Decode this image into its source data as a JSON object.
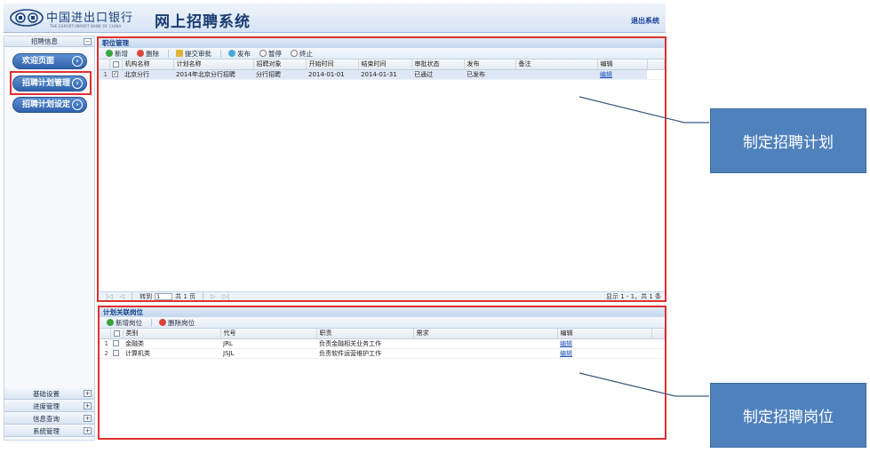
{
  "header": {
    "bank_name_cn": "中国进出口银行",
    "bank_name_en": "THE EXPORT-IMPORT BANK OF CHINA",
    "system_title": "网上招聘系统",
    "logout": "退出系统"
  },
  "sidebar": {
    "section_title": "招聘信息",
    "buttons": [
      {
        "label": "欢迎页面"
      },
      {
        "label": "招聘计划管理"
      },
      {
        "label": "招聘计划设定"
      }
    ],
    "accordion": [
      {
        "label": "基础设置"
      },
      {
        "label": "进度管理"
      },
      {
        "label": "信息查询"
      },
      {
        "label": "系统管理"
      }
    ]
  },
  "plan_panel": {
    "title": "职位管理",
    "toolbar": [
      "新增",
      "删除",
      "提交审批",
      "发布",
      "暂停",
      "终止"
    ],
    "columns": [
      "机构名称",
      "计划名称",
      "招聘对象",
      "开始时间",
      "结束时间",
      "审批状态",
      "发布",
      "备注",
      "编辑"
    ],
    "rows": [
      {
        "num": "1",
        "checked": "✓",
        "org": "北京分行",
        "plan": "2014年北京分行招聘",
        "target": "分行招聘",
        "start": "2014-01-01",
        "end": "2014-01-31",
        "status": "已通过",
        "publish": "已发布",
        "remark": "",
        "edit": "编辑"
      }
    ],
    "pager": {
      "goto_label": "转到",
      "page_value": "1",
      "total_pages": "共 1 页",
      "summary": "显示 1 - 1，共 1 条"
    }
  },
  "post_panel": {
    "title": "计划关联岗位",
    "toolbar": [
      "新增岗位",
      "删除岗位"
    ],
    "columns": [
      "类别",
      "代号",
      "职责",
      "需求",
      "编辑"
    ],
    "rows": [
      {
        "num": "1",
        "category": "金融类",
        "code": "JRL",
        "duty": "负责金融相关业务工作",
        "need": "",
        "edit": "编辑"
      },
      {
        "num": "2",
        "category": "计算机类",
        "code": "JSJL",
        "duty": "负责软件运营维护工作",
        "need": "",
        "edit": "编辑"
      }
    ]
  },
  "callouts": {
    "plan": "制定招聘计划",
    "post": "制定招聘岗位"
  },
  "colors": {
    "accent": "#4f81bd",
    "highlight_red": "#e03030",
    "header_blue": "#15428b"
  }
}
